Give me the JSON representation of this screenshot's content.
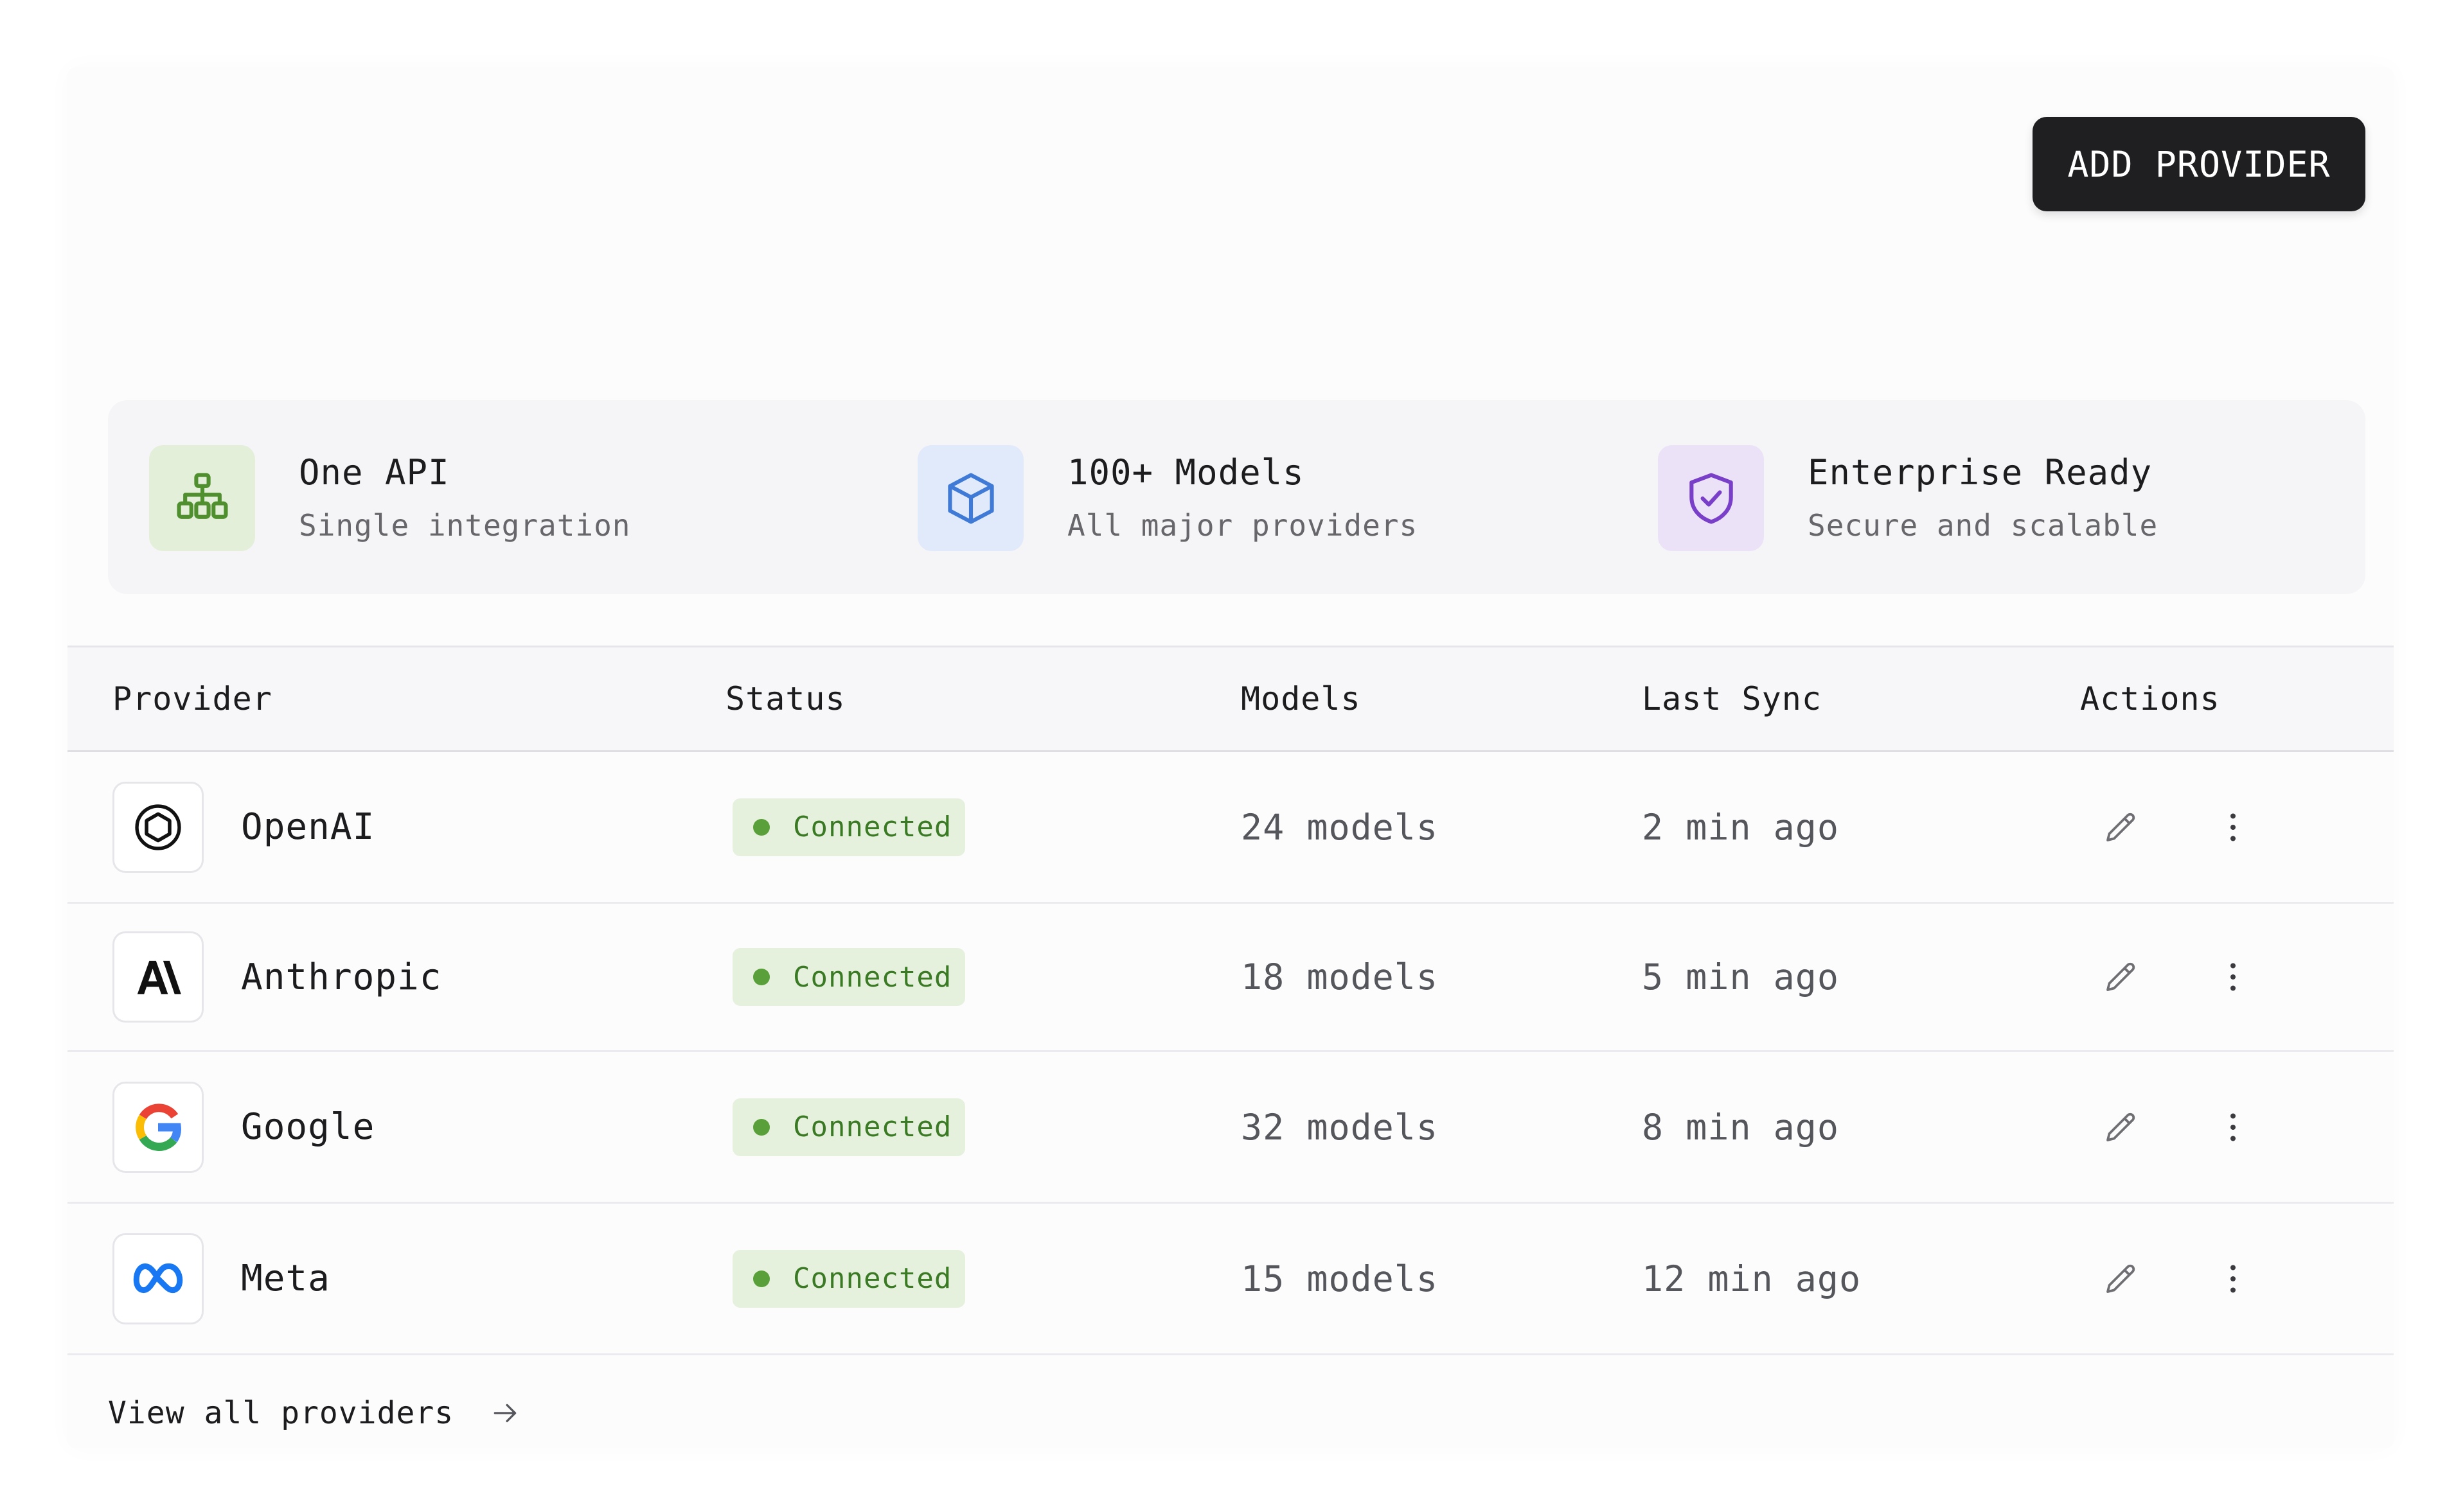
{
  "header": {
    "add_button_label": "ADD PROVIDER"
  },
  "features": [
    {
      "title": "One API",
      "subtitle": "Single integration",
      "icon": "hierarchy-icon",
      "color": "#4f8f2e",
      "bg": "#e3efd9"
    },
    {
      "title": "100+ Models",
      "subtitle": "All major providers",
      "icon": "cube-icon",
      "color": "#3f7bd6",
      "bg": "#e1eafa"
    },
    {
      "title": "Enterprise Ready",
      "subtitle": "Secure and scalable",
      "icon": "shield-check-icon",
      "color": "#7a3fc8",
      "bg": "#ece2f8"
    }
  ],
  "table": {
    "columns": [
      "Provider",
      "Status",
      "Models",
      "Last Sync",
      "Actions"
    ],
    "rows": [
      {
        "provider": "OpenAI",
        "logo": "openai-icon",
        "status": "Connected",
        "models": "24 models",
        "last_sync": "2 min ago"
      },
      {
        "provider": "Anthropic",
        "logo": "anthropic-icon",
        "status": "Connected",
        "models": "18 models",
        "last_sync": "5 min ago"
      },
      {
        "provider": "Google",
        "logo": "google-icon",
        "status": "Connected",
        "models": "32 models",
        "last_sync": "8 min ago"
      },
      {
        "provider": "Meta",
        "logo": "meta-icon",
        "status": "Connected",
        "models": "15 models",
        "last_sync": "12 min ago"
      }
    ]
  },
  "footer": {
    "view_all_label": "View all providers"
  },
  "colors": {
    "status_connected": "#5aa03a",
    "status_bg": "#e6f1dd",
    "button_bg": "#1f1f21"
  }
}
